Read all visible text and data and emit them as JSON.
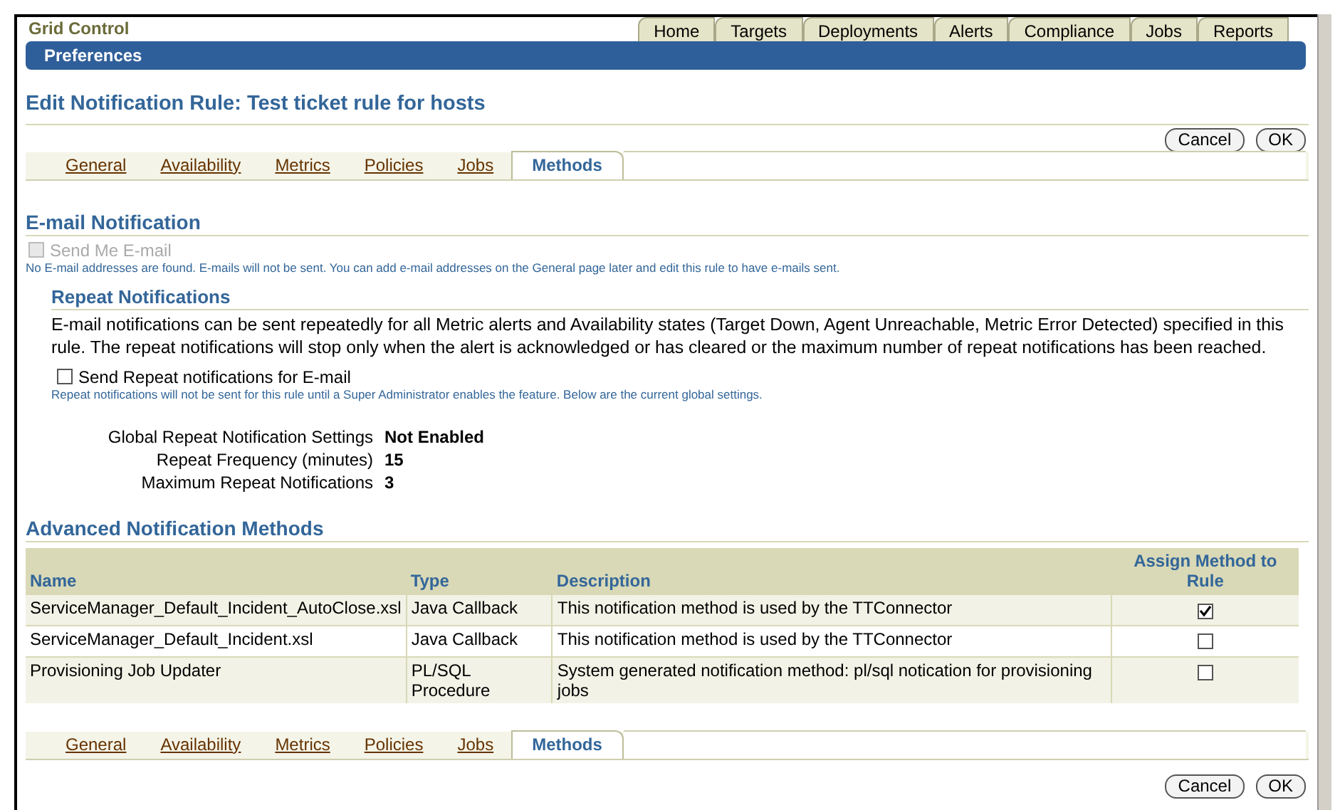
{
  "brand": "Grid Control",
  "global_tabs": [
    {
      "label": "Home",
      "selected": false
    },
    {
      "label": "Targets",
      "selected": false
    },
    {
      "label": "Deployments",
      "selected": false
    },
    {
      "label": "Alerts",
      "selected": false
    },
    {
      "label": "Compliance",
      "selected": false
    },
    {
      "label": "Jobs",
      "selected": false
    },
    {
      "label": "Reports",
      "selected": false
    }
  ],
  "nav_bar": {
    "label": "Preferences"
  },
  "page_title": "Edit Notification Rule: Test ticket rule for hosts",
  "buttons": [
    "Cancel",
    "OK"
  ],
  "subtabs": [
    {
      "label": "General",
      "selected": false
    },
    {
      "label": "Availability",
      "selected": false
    },
    {
      "label": "Metrics",
      "selected": false
    },
    {
      "label": "Policies",
      "selected": false
    },
    {
      "label": "Jobs",
      "selected": false
    },
    {
      "label": "Methods",
      "selected": true
    }
  ],
  "bottom_subtabs": [
    {
      "label": "General",
      "selected": false
    },
    {
      "label": "Availability",
      "selected": false
    },
    {
      "label": "Metrics",
      "selected": false
    },
    {
      "label": "Policies",
      "selected": false
    },
    {
      "label": "Jobs",
      "selected": false
    },
    {
      "label": "Methods",
      "selected": true
    }
  ],
  "bottom_buttons": [
    "Cancel",
    "OK"
  ],
  "email": {
    "heading": "E-mail Notification",
    "send_me": {
      "label": "Send Me E-mail",
      "checked": false,
      "disabled": true
    },
    "hint": "No E-mail addresses are found. E-mails will not be sent. You can add e-mail addresses on the General page later and edit this rule to have e-mails sent."
  },
  "repeat": {
    "heading": "Repeat Notifications",
    "description": "E-mail notifications can be sent repeatedly for all Metric alerts and Availability states (Target Down, Agent Unreachable, Metric Error Detected) specified in this rule. The repeat notifications will stop only when the alert is acknowledged or has cleared or the maximum number of repeat notifications has been reached.",
    "send_repeat": {
      "label": "Send Repeat notifications for E-mail",
      "checked": false,
      "disabled": false
    },
    "hint": "Repeat notifications will not be sent for this rule until a Super Administrator enables the feature. Below are the current global settings.",
    "settings": [
      {
        "label": "Global Repeat Notification Settings",
        "value": "Not Enabled"
      },
      {
        "label": "Repeat Frequency (minutes)",
        "value": "15"
      },
      {
        "label": "Maximum Repeat Notifications",
        "value": "3"
      }
    ]
  },
  "methods": {
    "heading": "Advanced Notification Methods",
    "columns": [
      "Name",
      "Type",
      "Description",
      "Assign Method to Rule"
    ],
    "rows": [
      {
        "name": "ServiceManager_Default_Incident_AutoClose.xsl",
        "type": "Java Callback",
        "description": "This notification method is used by the TTConnector",
        "checked": true
      },
      {
        "name": "ServiceManager_Default_Incident.xsl",
        "type": "Java Callback",
        "description": "This notification method is used by the TTConnector",
        "checked": false
      },
      {
        "name": "Provisioning Job Updater",
        "type": "PL/SQL Procedure",
        "description": "System generated notification method: pl/sql notication for provisioning jobs",
        "checked": false
      }
    ]
  }
}
